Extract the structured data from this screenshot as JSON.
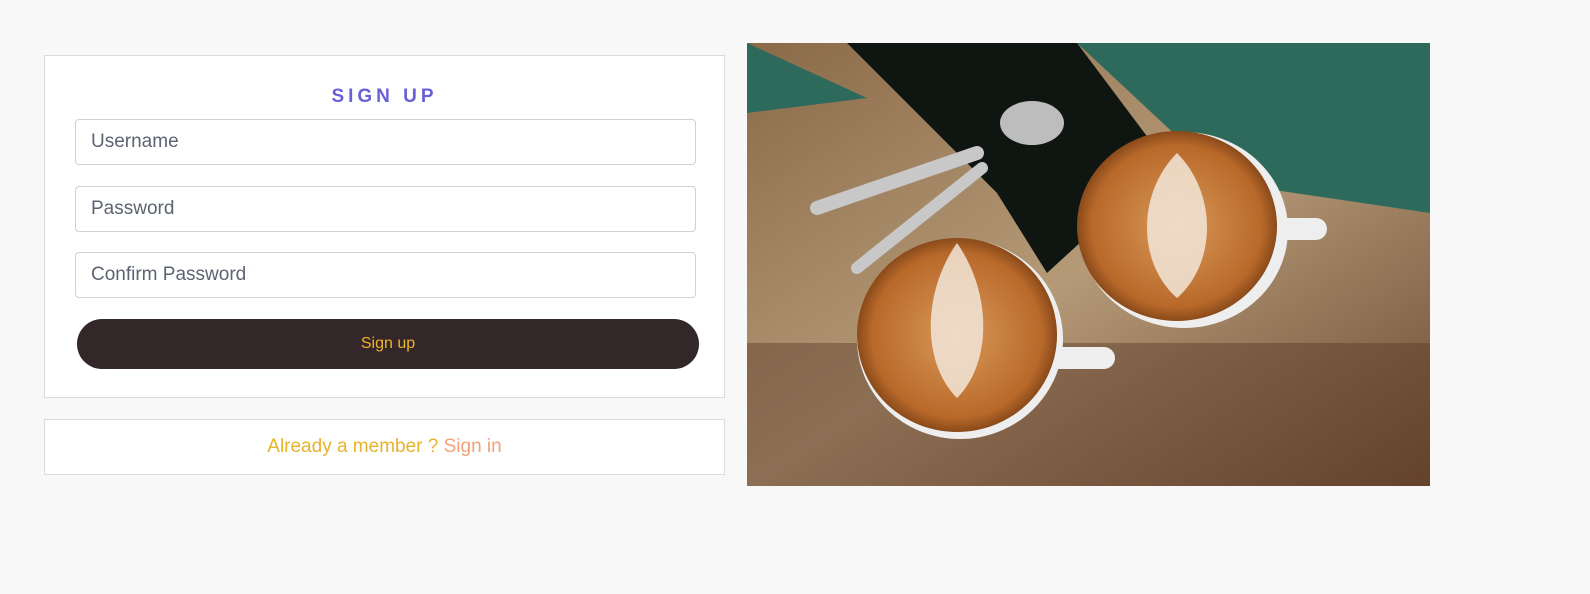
{
  "signup": {
    "title": "SIGN UP",
    "username_placeholder": "Username",
    "password_placeholder": "Password",
    "confirm_placeholder": "Confirm Password",
    "submit_label": "Sign up"
  },
  "signin_prompt": {
    "text": "Already a member ? ",
    "link": "Sign in"
  },
  "colors": {
    "title": "#6a5fd6",
    "button_bg": "#332729",
    "button_text": "#f0b429",
    "prompt_text": "#e8b22a",
    "link": "#f4a07a"
  }
}
